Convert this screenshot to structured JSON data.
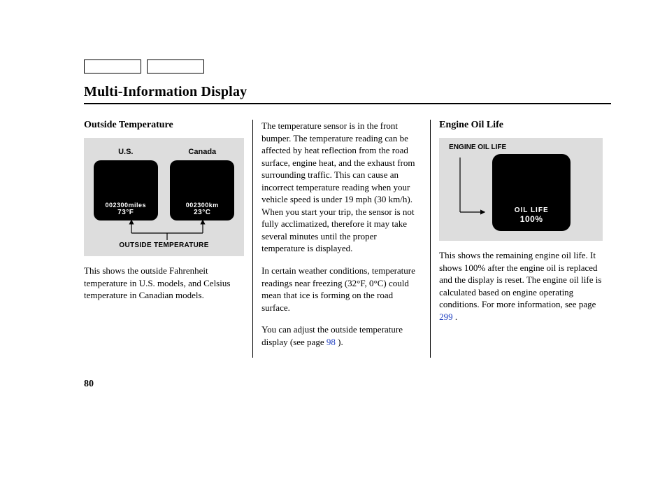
{
  "header": {
    "title": "Multi-Information Display"
  },
  "col1": {
    "subhead": "Outside Temperature",
    "figure": {
      "us_label": "U.S.",
      "canada_label": "Canada",
      "us_odometer": "002300miles",
      "us_temp": "73°F",
      "ca_odometer": "002300km",
      "ca_temp": "23°C",
      "caption": "OUTSIDE TEMPERATURE"
    },
    "p1": "This shows the outside Fahrenheit temperature in U.S. models, and Celsius temperature in Canadian models."
  },
  "col2": {
    "p1": "The temperature sensor is in the front bumper. The temperature reading can be affected by heat reflection from the road surface, engine heat, and the exhaust from surrounding traffic. This can cause an incorrect temperature reading when your vehicle speed is under 19 mph (30 km/h). When you start your trip, the sensor is not fully acclimatized, therefore it may take several minutes until the proper temperature is displayed.",
    "p2_a": "In certain weather conditions, temperature readings near freezing (32°F, 0°C) could mean that ice is forming on the road surface.",
    "p3_a": "You can adjust the outside temperature display (see page ",
    "p3_link": "98",
    "p3_b": " )."
  },
  "col3": {
    "subhead": "Engine Oil Life",
    "figure": {
      "label": "ENGINE OIL LIFE",
      "screen_line1": "OIL LIFE",
      "screen_line2": "100%"
    },
    "p1_a": "This shows the remaining engine oil life. It shows 100% after the engine oil is replaced and the display is reset. The engine oil life is calculated based on engine operating conditions. For more information, see page ",
    "p1_link": "299",
    "p1_b": " ."
  },
  "page_number": "80"
}
